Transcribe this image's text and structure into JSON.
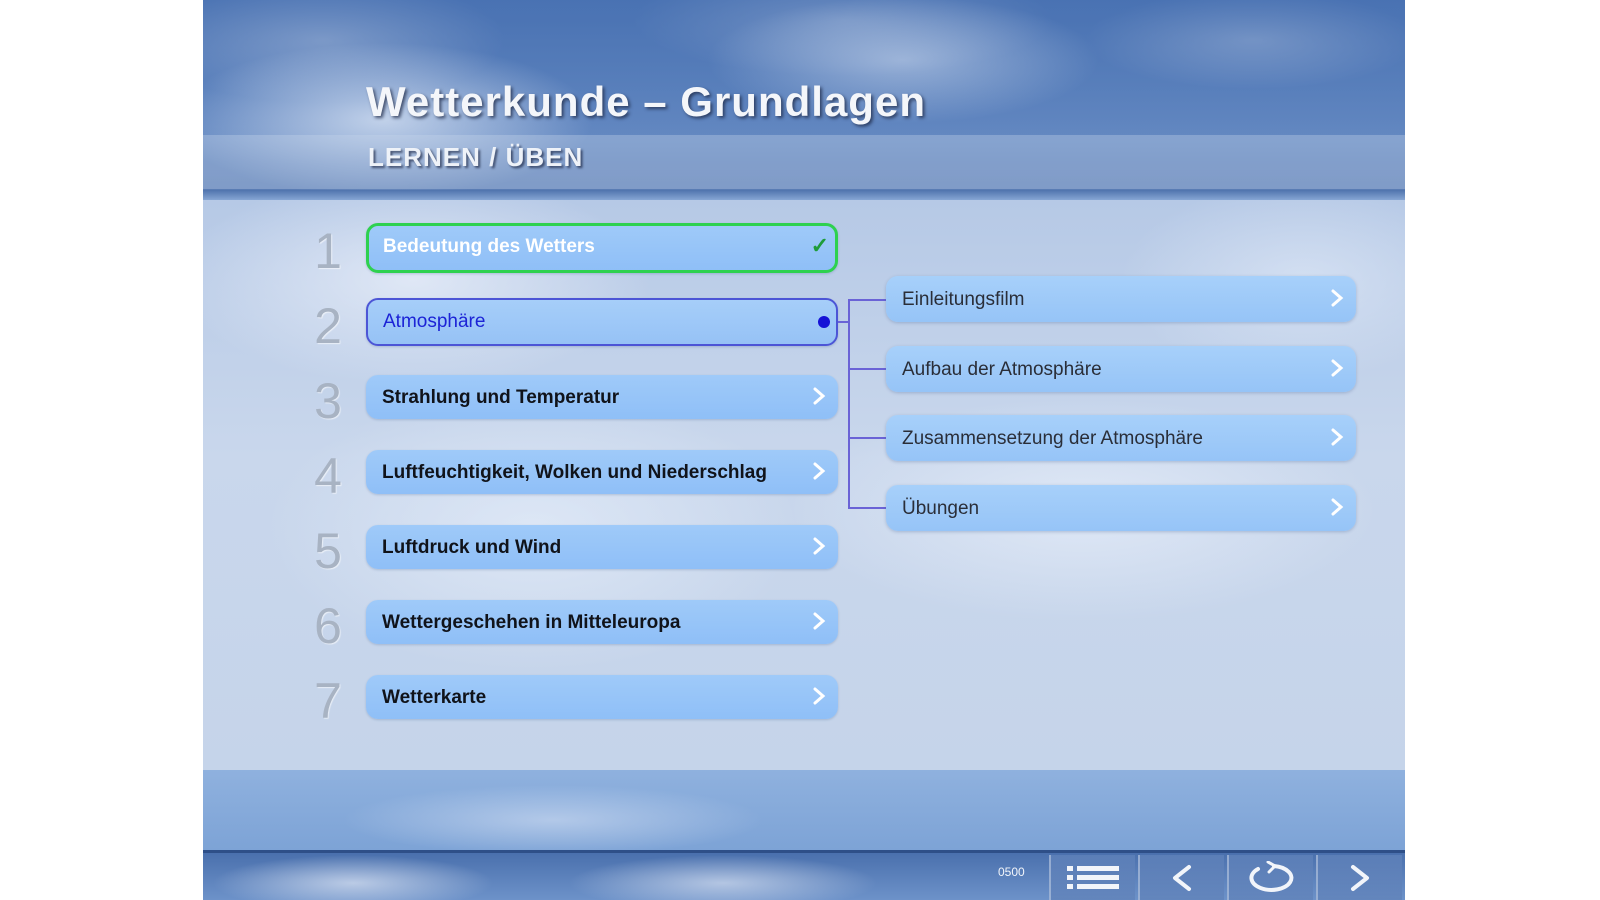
{
  "header": {
    "title": "Wetterkunde – Grundlagen",
    "subtitle": "LERNEN / ÜBEN"
  },
  "chapters": [
    {
      "number": "1",
      "label": "Bedeutung des Wetters",
      "state": "completed"
    },
    {
      "number": "2",
      "label": "Atmosphäre",
      "state": "active"
    },
    {
      "number": "3",
      "label": "Strahlung und Temperatur",
      "state": "default"
    },
    {
      "number": "4",
      "label": "Luftfeuchtigkeit, Wolken und Niederschlag",
      "state": "default"
    },
    {
      "number": "5",
      "label": "Luftdruck und Wind",
      "state": "default"
    },
    {
      "number": "6",
      "label": "Wettergeschehen in Mitteleuropa",
      "state": "default"
    },
    {
      "number": "7",
      "label": "Wetterkarte",
      "state": "default"
    }
  ],
  "subchapters": [
    {
      "label": "Einleitungsfilm"
    },
    {
      "label": "Aufbau der Atmosphäre"
    },
    {
      "label": "Zusammensetzung der Atmosphäre"
    },
    {
      "label": "Übungen"
    }
  ],
  "toolbar": {
    "page_counter": "0500",
    "buttons": [
      {
        "icon": "list-icon"
      },
      {
        "icon": "back-arrow-icon"
      },
      {
        "icon": "reload-icon"
      },
      {
        "icon": "forward-arrow-icon"
      }
    ]
  },
  "colors": {
    "completed_border": "#2ed14f",
    "active_border": "#4c55d6",
    "active_text": "#1c23d6",
    "pill_fill": "#96c4f7"
  }
}
